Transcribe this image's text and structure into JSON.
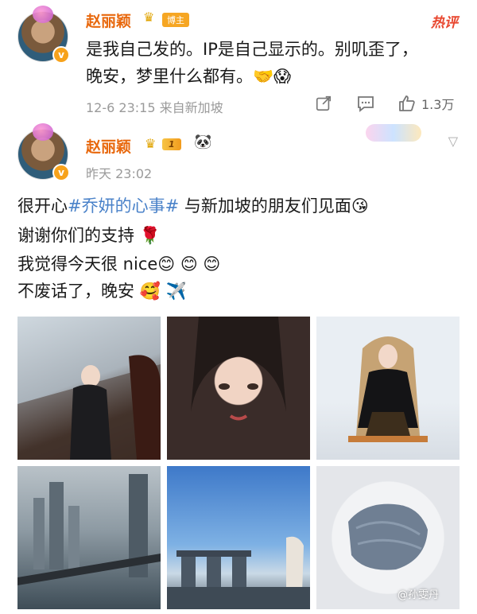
{
  "post1": {
    "username": "赵丽颖",
    "badge_host": "博主",
    "hot_label": "热评",
    "text": "是我自己发的。IP是自己显示的。别叽歪了，晚安，梦里什么都有。🤝😱",
    "text_line1": "是我自己发的。IP是自己显示的。别叽歪了，",
    "text_line2": "晚安，梦里什么都有。",
    "emoji1": "🤝",
    "emoji2": "😱",
    "meta": "12-6 23:15 来自新加坡",
    "like_count": "1.3万"
  },
  "post2": {
    "username": "赵丽颖",
    "level": "1",
    "time": "昨天 23:02",
    "line1_pre": "很开心",
    "hashtag": "#乔妍的心事#",
    "line1_post": " 与新加坡的朋友们见面",
    "line1_emoji": "😘",
    "line2": "谢谢你们的支持",
    "line2_emoji": "🌹",
    "line3": "我觉得今天很 nice",
    "line3_emoji": "😊 😊 😊",
    "line4": "不废话了，晚安",
    "line4_emoji": "🥰 ✈️",
    "watermark": "@孙雯丹"
  },
  "icons": {
    "share": "share-icon",
    "comment": "comment-icon",
    "like": "like-icon",
    "chevron": "chevron-down-icon",
    "panda": "panda-icon",
    "crown": "crown-icon"
  },
  "colors": {
    "username": "#e8680d",
    "hashtag": "#4a82c9",
    "hot": "#e8472f",
    "meta": "#9a9a9a"
  }
}
